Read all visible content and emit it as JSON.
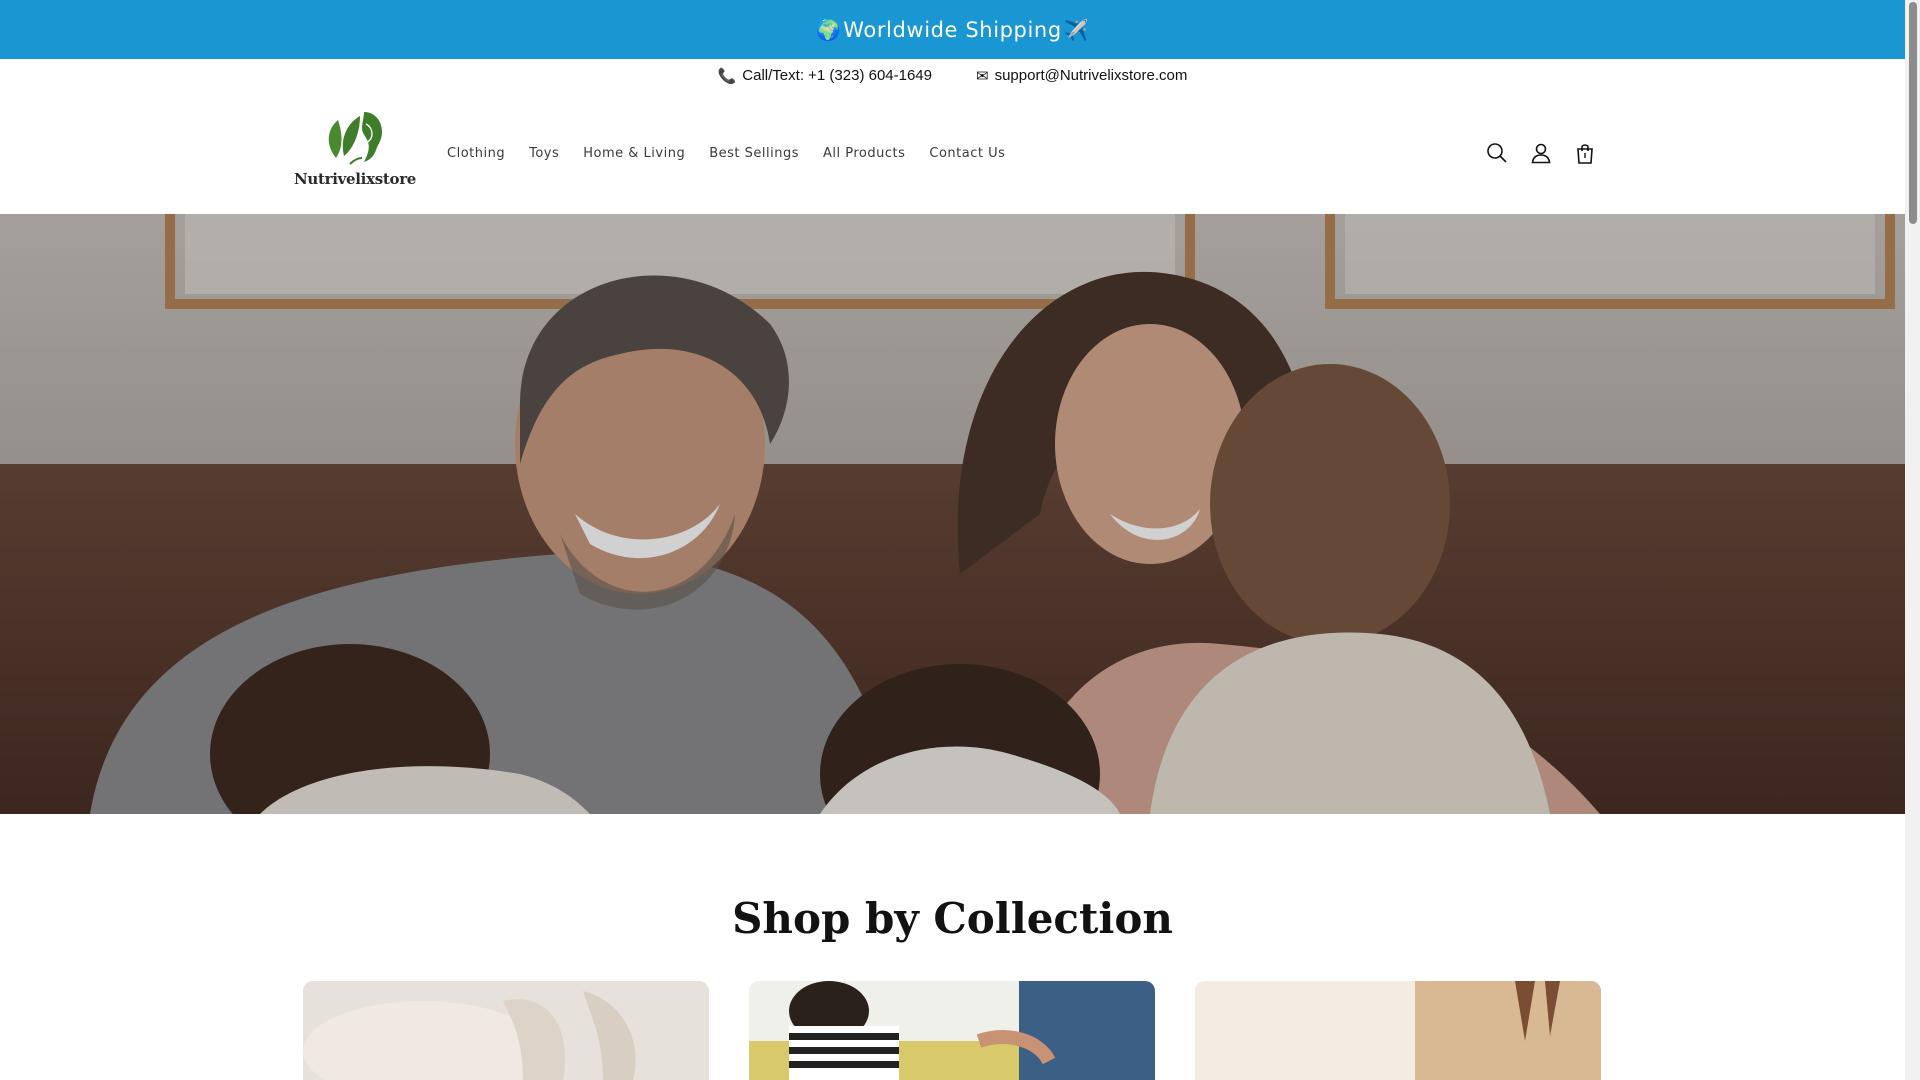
{
  "announcement": {
    "globe_icon": "🌍",
    "text": "Worldwide Shipping",
    "plane_icon": "✈️",
    "background": "#1a96d2"
  },
  "contact": {
    "phone_icon": "📞",
    "phone": "Call/Text: +1 (323) 604-1649",
    "email_icon": "✉",
    "email": "support@Nutrivelixstore.com"
  },
  "logo": {
    "name": "Nutrivelixstore",
    "leaf_color": "#3e7d2a"
  },
  "nav": {
    "items": [
      "Clothing",
      "Toys",
      "Home & Living",
      "Best Sellings",
      "All Products",
      "Contact Us"
    ]
  },
  "header_icons": [
    "search-icon",
    "account-icon",
    "cart-icon"
  ],
  "hero": {
    "description_icon": "family-photo"
  },
  "collection": {
    "title": "Shop by Collection"
  }
}
